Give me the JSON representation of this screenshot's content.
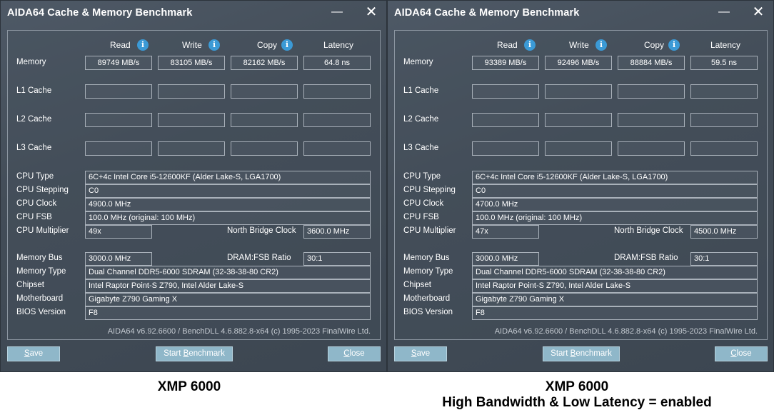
{
  "windows": [
    {
      "title": "AIDA64 Cache & Memory Benchmark",
      "minimize_glyph": "—",
      "close_glyph": "✕",
      "columns": {
        "read": "Read",
        "write": "Write",
        "copy": "Copy",
        "latency": "Latency"
      },
      "info_glyph": "i",
      "memory": {
        "label": "Memory",
        "read": "89749 MB/s",
        "write": "83105 MB/s",
        "copy": "82162 MB/s",
        "latency": "64.8 ns"
      },
      "l1": {
        "label": "L1 Cache",
        "read": "",
        "write": "",
        "copy": "",
        "latency": ""
      },
      "l2": {
        "label": "L2 Cache",
        "read": "",
        "write": "",
        "copy": "",
        "latency": ""
      },
      "l3": {
        "label": "L3 Cache",
        "read": "",
        "write": "",
        "copy": "",
        "latency": ""
      },
      "cpu_type": {
        "label": "CPU Type",
        "value": "6C+4c Intel Core i5-12600KF  (Alder Lake-S, LGA1700)"
      },
      "cpu_stepping": {
        "label": "CPU Stepping",
        "value": "C0"
      },
      "cpu_clock": {
        "label": "CPU Clock",
        "value": "4900.0 MHz"
      },
      "cpu_fsb": {
        "label": "CPU FSB",
        "value": "100.0 MHz  (original: 100 MHz)"
      },
      "cpu_multiplier": {
        "label": "CPU Multiplier",
        "value": "49x"
      },
      "north_bridge_clock": {
        "label": "North Bridge Clock",
        "value": "3600.0 MHz"
      },
      "memory_bus": {
        "label": "Memory Bus",
        "value": "3000.0 MHz"
      },
      "dram_fsb": {
        "label": "DRAM:FSB Ratio",
        "value": "30:1"
      },
      "memory_type": {
        "label": "Memory Type",
        "value": "Dual Channel DDR5-6000 SDRAM  (32-38-38-80 CR2)"
      },
      "chipset": {
        "label": "Chipset",
        "value": "Intel Raptor Point-S Z790, Intel Alder Lake-S"
      },
      "motherboard": {
        "label": "Motherboard",
        "value": "Gigabyte Z790 Gaming X"
      },
      "bios": {
        "label": "BIOS Version",
        "value": "F8"
      },
      "footer": "AIDA64 v6.92.6600 / BenchDLL 4.6.882.8-x64  (c) 1995-2023 FinalWire Ltd.",
      "buttons": {
        "save": {
          "underlined": "S",
          "rest": "ave"
        },
        "start": {
          "before": "Start ",
          "underlined": "B",
          "rest": "enchmark"
        },
        "close": {
          "underlined": "C",
          "rest": "lose"
        }
      }
    },
    {
      "title": "AIDA64 Cache & Memory Benchmark",
      "minimize_glyph": "—",
      "close_glyph": "✕",
      "columns": {
        "read": "Read",
        "write": "Write",
        "copy": "Copy",
        "latency": "Latency"
      },
      "info_glyph": "i",
      "memory": {
        "label": "Memory",
        "read": "93389 MB/s",
        "write": "92496 MB/s",
        "copy": "88884 MB/s",
        "latency": "59.5 ns"
      },
      "l1": {
        "label": "L1 Cache",
        "read": "",
        "write": "",
        "copy": "",
        "latency": ""
      },
      "l2": {
        "label": "L2 Cache",
        "read": "",
        "write": "",
        "copy": "",
        "latency": ""
      },
      "l3": {
        "label": "L3 Cache",
        "read": "",
        "write": "",
        "copy": "",
        "latency": ""
      },
      "cpu_type": {
        "label": "CPU Type",
        "value": "6C+4c Intel Core i5-12600KF  (Alder Lake-S, LGA1700)"
      },
      "cpu_stepping": {
        "label": "CPU Stepping",
        "value": "C0"
      },
      "cpu_clock": {
        "label": "CPU Clock",
        "value": "4700.0 MHz"
      },
      "cpu_fsb": {
        "label": "CPU FSB",
        "value": "100.0 MHz  (original: 100 MHz)"
      },
      "cpu_multiplier": {
        "label": "CPU Multiplier",
        "value": "47x"
      },
      "north_bridge_clock": {
        "label": "North Bridge Clock",
        "value": "4500.0 MHz"
      },
      "memory_bus": {
        "label": "Memory Bus",
        "value": "3000.0 MHz"
      },
      "dram_fsb": {
        "label": "DRAM:FSB Ratio",
        "value": "30:1"
      },
      "memory_type": {
        "label": "Memory Type",
        "value": "Dual Channel DDR5-6000 SDRAM  (32-38-38-80 CR2)"
      },
      "chipset": {
        "label": "Chipset",
        "value": "Intel Raptor Point-S Z790, Intel Alder Lake-S"
      },
      "motherboard": {
        "label": "Motherboard",
        "value": "Gigabyte Z790 Gaming X"
      },
      "bios": {
        "label": "BIOS Version",
        "value": "F8"
      },
      "footer": "AIDA64 v6.92.6600 / BenchDLL 4.6.882.8-x64  (c) 1995-2023 FinalWire Ltd.",
      "buttons": {
        "save": {
          "underlined": "S",
          "rest": "ave"
        },
        "start": {
          "before": "Start ",
          "underlined": "B",
          "rest": "enchmark"
        },
        "close": {
          "underlined": "C",
          "rest": "lose"
        }
      }
    }
  ],
  "captions": {
    "left": "XMP 6000",
    "right_line1": "XMP 6000",
    "right_line2": "High Bandwidth & Low Latency = enabled"
  }
}
